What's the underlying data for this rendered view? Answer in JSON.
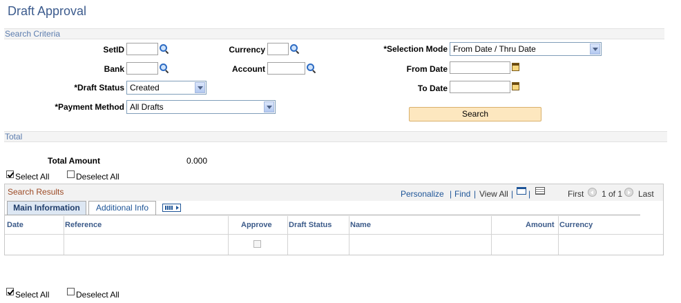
{
  "page": {
    "title": "Draft Approval"
  },
  "search_criteria": {
    "header": "Search Criteria",
    "setid_label": "SetID",
    "setid_value": "",
    "bank_label": "Bank",
    "bank_value": "",
    "currency_label": "Currency",
    "currency_value": "",
    "account_label": "Account",
    "account_value": "",
    "draft_status_label": "*Draft Status",
    "draft_status_value": "Created",
    "payment_method_label": "*Payment Method",
    "payment_method_value": "All Drafts",
    "selection_mode_label": "*Selection Mode",
    "selection_mode_value": "From Date / Thru Date",
    "from_date_label": "From Date",
    "from_date_value": "",
    "to_date_label": "To Date",
    "to_date_value": "",
    "search_button": "Search"
  },
  "total": {
    "header": "Total",
    "total_amount_label": "Total Amount",
    "total_amount_value": "0.000"
  },
  "select_all_top": {
    "select_all": "Select All",
    "deselect_all": "Deselect All",
    "select_all_checked": true
  },
  "select_all_bottom": {
    "select_all": "Select All",
    "deselect_all": "Deselect All",
    "select_all_checked": true
  },
  "results": {
    "title": "Search Results",
    "personalize": "Personalize",
    "find": "Find",
    "view_all": "View All",
    "sep": "|",
    "first": "First",
    "page_info": "1 of 1",
    "last": "Last",
    "tabs": [
      {
        "label": "Main Information",
        "active": true
      },
      {
        "label": "Additional Info",
        "active": false
      }
    ],
    "columns": {
      "date": "Date",
      "reference": "Reference",
      "approve": "Approve",
      "draft_status": "Draft Status",
      "name": "Name",
      "amount": "Amount",
      "currency": "Currency"
    },
    "rows": [
      {
        "date": "",
        "reference": "",
        "approve": false,
        "draft_status": "",
        "name": "",
        "amount": "",
        "currency": ""
      }
    ]
  },
  "colors": {
    "title": "#3c5b8d",
    "section_text": "#5b7cae",
    "link": "#1d5497",
    "grid_title": "#9c4a25",
    "search_button_bg": "#fde7bf"
  }
}
